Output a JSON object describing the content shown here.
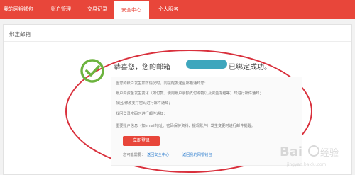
{
  "nav": {
    "tabs": [
      "我的网银钱包",
      "账户管理",
      "交易记录",
      "安全中心",
      "个人服务"
    ],
    "active_index": 3
  },
  "panel": {
    "title": "绑定邮箱"
  },
  "success": {
    "prefix": "恭喜您，您的邮箱",
    "suffix": "已绑定成功。"
  },
  "info": {
    "lines": [
      "当您的账户发生如下情况时，同提醒发送至邮箱通知您：",
      "账户内资金发生变化（如付款、使用账户余额支付购物以及资金冻结等）时进行邮件通知；",
      "找回/修改支付密码进行邮件通知；",
      "找回登录密码时进行邮件通知；",
      "重要账户信息（如email地址、密码保护资料、提现账户）发生变更时进行邮件提醒。"
    ],
    "login_button": "立即登录",
    "more_label": "您可能需要：",
    "link1": "返回安全中心",
    "link2": "返回我的网银钱包"
  },
  "colors": {
    "accent": "#e8463a",
    "ellipse": "#d9303c",
    "success_green": "#6cb33e",
    "email_highlight": "#3ea6bd",
    "link": "#2f7fcf"
  },
  "icons": {
    "check": "check-circle-icon"
  },
  "watermark": {
    "text": "Bai 经验",
    "subtext": "jingyan.baidu.com"
  }
}
